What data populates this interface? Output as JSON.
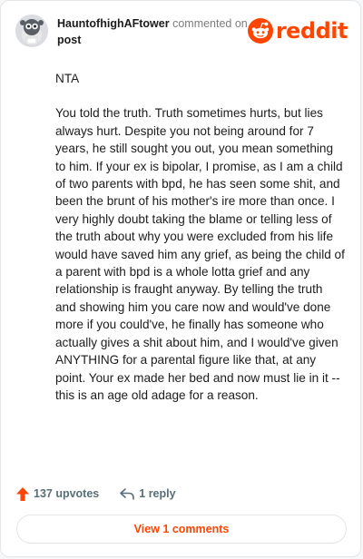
{
  "header": {
    "username": "HauntofhighAFtower",
    "commented_text": "commented on",
    "post_link": "post",
    "logo_text": "reddit",
    "brand_color": "#ff4500"
  },
  "comment": {
    "paragraphs": [
      "NTA",
      "You told the truth. Truth sometimes hurts, but lies always hurt. Despite you not being around for 7 years, he still sought you out, you mean something to him. If your ex is bipolar, I promise, as I am a child of two parents with bpd, he has seen some shit, and been the brunt of his mother's ire more than once. I very highly doubt taking the blame or telling less of the truth about why you were excluded from his life would have saved him any grief, as being the child of a parent with bpd is a whole lotta grief and any relationship is fraught anyway. By telling the truth and showing him you care now and would've done more if you could've, he finally has someone who actually gives a shit about him, and I would've given ANYTHING for a parental figure like that, at any point. Your ex made her bed and now must lie in it -- this is an age old adage for a reason."
    ]
  },
  "actions": {
    "upvotes": "137 upvotes",
    "reply": "1 reply",
    "upvote_icon": "upvote-arrow-icon",
    "reply_icon": "reply-arrow-icon"
  },
  "view_comments": "View 1 comments"
}
